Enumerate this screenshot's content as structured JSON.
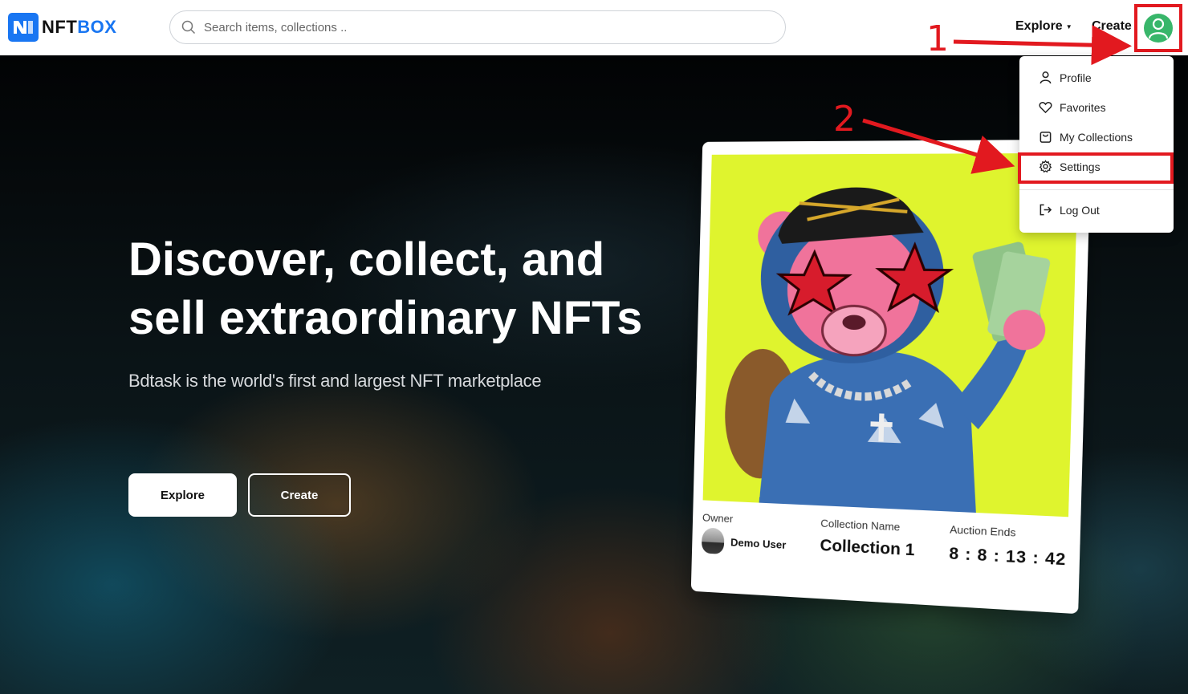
{
  "header": {
    "logo_text_part1": "NFT",
    "logo_text_part2": "BOX",
    "search_placeholder": "Search items, collections ..",
    "nav_explore": "Explore",
    "nav_create": "Create"
  },
  "hero": {
    "title": "Discover, collect, and sell extraordinary NFTs",
    "subtitle": "Bdtask is the world's first and largest NFT marketplace",
    "explore_button": "Explore",
    "create_button": "Create"
  },
  "card": {
    "owner_label": "Owner",
    "owner_name": "Demo User",
    "collection_label": "Collection Name",
    "collection_name": "Collection 1",
    "auction_label": "Auction Ends",
    "auction_time": "8 : 8 : 13 : 42"
  },
  "dropdown": {
    "items": [
      {
        "label": "Profile",
        "icon": "person-icon"
      },
      {
        "label": "Favorites",
        "icon": "heart-icon"
      },
      {
        "label": "My Collections",
        "icon": "bag-icon"
      },
      {
        "label": "Settings",
        "icon": "gear-icon"
      },
      {
        "label": "Log Out",
        "icon": "logout-icon"
      }
    ]
  },
  "annotations": {
    "step1": "1",
    "step2": "2",
    "color": "#e2191f"
  },
  "colors": {
    "brand": "#1976f2",
    "avatar": "#38b66a",
    "art_background": "#dff42e"
  }
}
